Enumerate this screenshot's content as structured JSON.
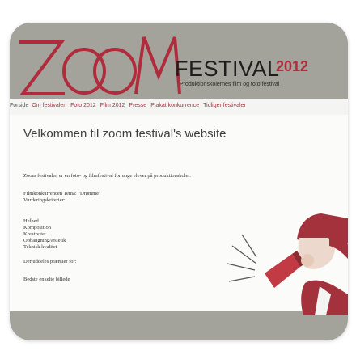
{
  "header": {
    "logo_text": "ZOOM",
    "festival": "FESTIVAL",
    "year": "2012",
    "tagline": "Produktionskolernes film og foto festival"
  },
  "nav": {
    "items": [
      "Forside",
      "Om festivalen",
      "Foto 2012",
      "Film 2012",
      "Presse",
      "Plakat konkurrence",
      "Tidliger festivaler"
    ]
  },
  "main": {
    "title": "Velkommen til zoom festival's website",
    "intro": "Zoom festivalen er en foto- og filmfestival for unge elever på produktionskoler.",
    "theme": "Filmkonkurrencen Tema: \"Drømme\"",
    "criteria_label": "Vurderingskriterier:",
    "criteria": [
      "Helhed",
      "Komposition",
      "Kreativitet",
      "Opbangning/æstetik",
      "Teknisk kvalitet"
    ],
    "prizes_label": "Der uddeles præmier for:",
    "prize_1": "Bedste enkelte billede"
  },
  "colors": {
    "brand_red": "#b02b3b",
    "header_gray": "#a3a39c",
    "nav_link": "#a33545"
  },
  "illustration": "megaphone-figure"
}
